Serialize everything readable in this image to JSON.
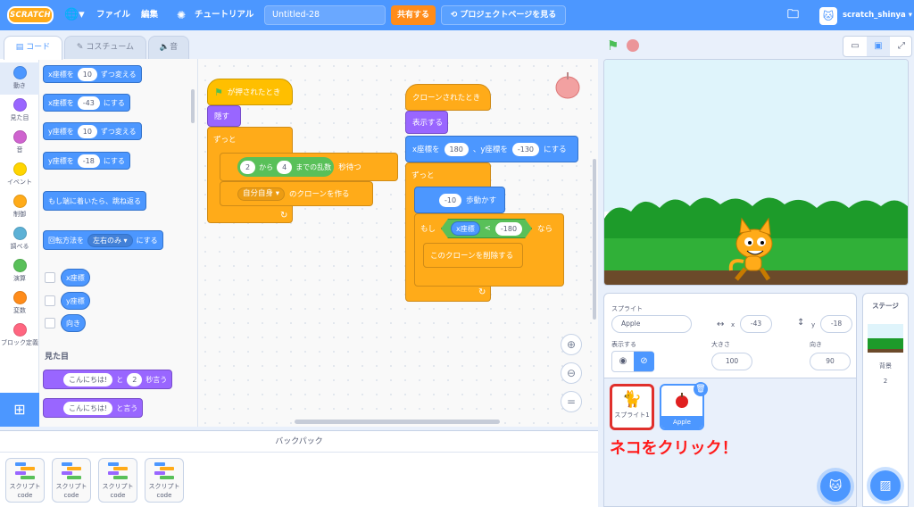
{
  "menubar": {
    "logo": "SCRATCH",
    "file": "ファイル",
    "edit": "編集",
    "tutorials": "チュートリアル",
    "project_title": "Untitled-28",
    "share": "共有する",
    "see_project_page": "プロジェクトページを見る",
    "username": "scratch_shinya"
  },
  "tabs": {
    "code": "コード",
    "costumes": "コスチューム",
    "sounds": "音"
  },
  "categories": [
    {
      "label": "動き",
      "color": "#4c97ff"
    },
    {
      "label": "見た目",
      "color": "#9966ff"
    },
    {
      "label": "音",
      "color": "#cf63cf"
    },
    {
      "label": "イベント",
      "color": "#ffd500"
    },
    {
      "label": "制御",
      "color": "#ffab19"
    },
    {
      "label": "調べる",
      "color": "#5cb1d6"
    },
    {
      "label": "演算",
      "color": "#59c059"
    },
    {
      "label": "変数",
      "color": "#ff8c1a"
    },
    {
      "label": "ブロック定義",
      "color": "#ff6680"
    }
  ],
  "palette": {
    "change_x": {
      "pre": "x座標を",
      "val": "10",
      "post": "ずつ変える"
    },
    "set_x": {
      "pre": "x座標を",
      "val": "-43",
      "post": "にする"
    },
    "change_y": {
      "pre": "y座標を",
      "val": "10",
      "post": "ずつ変える"
    },
    "set_y": {
      "pre": "y座標を",
      "val": "-18",
      "post": "にする"
    },
    "bounce": "もし端に着いたら、跳ね返る",
    "rotation": {
      "pre": "回転方法を",
      "val": "左右のみ ▾",
      "post": "にする"
    },
    "reporters": [
      "x座標",
      "y座標",
      "向き"
    ],
    "looks_heading": "見た目",
    "say_for": {
      "val": "こんにちは!",
      "mid": "と",
      "secs": "2",
      "post": "秒言う"
    },
    "say": {
      "val": "こんにちは!",
      "post": "と言う"
    }
  },
  "script1": {
    "hat": "が押されたとき",
    "hide": "隠す",
    "forever": "ずっと",
    "wait": {
      "a": "2",
      "from": "から",
      "b": "4",
      "mid": "までの乱数",
      "post": "秒待つ"
    },
    "clone": {
      "target": "自分自身 ▾",
      "post": "のクローンを作る"
    }
  },
  "script2": {
    "hat": "クローンされたとき",
    "show": "表示する",
    "goto": {
      "x_label": "x座標を",
      "x": "180",
      "y_label": "、y座標を",
      "y": "-130",
      "post": "にする"
    },
    "forever": "ずっと",
    "move": {
      "val": "-10",
      "post": "歩動かす"
    },
    "if": {
      "pre": "もし",
      "reporter": "x座標",
      "op": "<",
      "val": "-180",
      "post": "なら"
    },
    "delete": "このクローンを削除する"
  },
  "backpack": {
    "title": "バックパック",
    "items": [
      {
        "label": "スクリプト",
        "sub": "code"
      },
      {
        "label": "スクリプト",
        "sub": "code"
      },
      {
        "label": "スクリプト",
        "sub": "code"
      },
      {
        "label": "スクリプト",
        "sub": "code"
      }
    ]
  },
  "sprite_info": {
    "sprite_label": "スプライト",
    "name": "Apple",
    "x_label": "x",
    "x": "-43",
    "y_label": "y",
    "y": "-18",
    "show_label": "表示する",
    "size_label": "大きさ",
    "size": "100",
    "direction_label": "向き",
    "direction": "90"
  },
  "sprites": [
    {
      "name": "スプライト1",
      "selected": false
    },
    {
      "name": "Apple",
      "selected": true
    }
  ],
  "annotation": "ネコをクリック！",
  "stage_panel": {
    "title": "ステージ",
    "backdrops_label": "背景",
    "backdrops_count": "2"
  },
  "colors": {
    "accent": "#4c97ff",
    "annotation": "#ff1a1a",
    "highlight": "#e0302c"
  }
}
